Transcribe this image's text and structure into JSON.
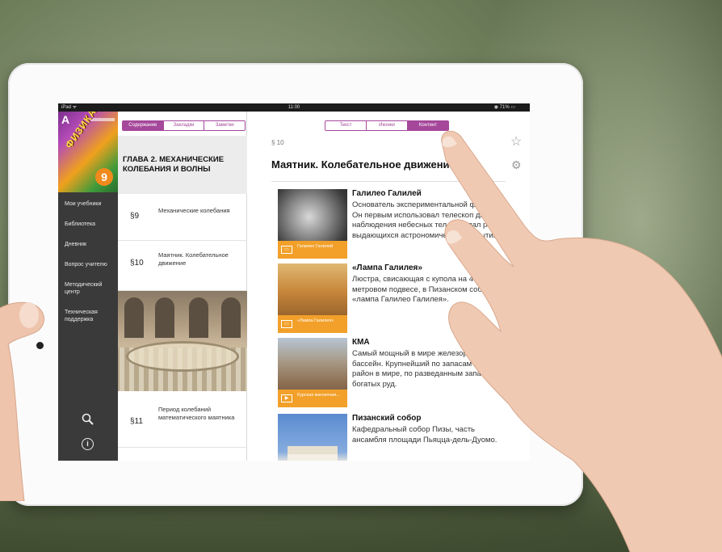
{
  "statusbar": {
    "carrier": "iPad ᯤ",
    "time": "11:00",
    "battery": "◉ 71% ▭"
  },
  "cover": {
    "letter": "A",
    "title": "ФИЗИКА",
    "grade": "9"
  },
  "sidebar": {
    "items": [
      {
        "label": "Мои учебники"
      },
      {
        "label": "Библиотека"
      },
      {
        "label": "Дневник"
      },
      {
        "label": "Вопрос учителю"
      },
      {
        "label": "Методический центр"
      },
      {
        "label": "Техническая поддержка"
      }
    ],
    "icons": {
      "search": "search-icon",
      "info": "info-icon",
      "info_glyph": "i"
    }
  },
  "toc": {
    "tabs": [
      {
        "label": "Содержание",
        "active": true
      },
      {
        "label": "Закладки",
        "active": false
      },
      {
        "label": "Заметки",
        "active": false
      }
    ],
    "chapter": "ГЛАВА 2. МЕХАНИЧЕСКИЕ КОЛЕБАНИЯ И ВОЛНЫ",
    "items": [
      {
        "num": "§9",
        "name": "Механические колебания"
      },
      {
        "num": "§10",
        "name": "Маятник. Колебательное движение"
      },
      {
        "num": "§11",
        "name": "Период колебаний математического маятника"
      }
    ]
  },
  "content": {
    "tabs": [
      {
        "label": "Текст",
        "active": false
      },
      {
        "label": "Иконки",
        "active": false
      },
      {
        "label": "Контент",
        "active": true
      }
    ],
    "paragraph": "§ 10",
    "title": "Маятник. Колебательное движение",
    "icons": {
      "star": "☆",
      "gear": "⚙"
    },
    "cards": [
      {
        "title": "Галилео Галилей",
        "text": "Основатель экспериментальной физики. Он первым использовал телескоп для наблюдения небесных тел и сделал ряд выдающихся астрономических открытий.",
        "caption": "Галилео Галилей",
        "icon": "image-icon",
        "glyph": "▭"
      },
      {
        "title": "«Лампа Галилея»",
        "text": "Люстра, свисающая с купола на 49-метровом подвесе, в Пизанском соборе — «лампа Галилео Галилея».",
        "caption": "«Лампа Галилея»",
        "icon": "image-icon",
        "glyph": "▭"
      },
      {
        "title": "КМА",
        "text": "Самый мощный в мире железорудный бассейн. Крупнейший по запасам железа район в мире, по разведанным запасам богатых руд.",
        "caption": "Курская магнитная...",
        "icon": "video-icon",
        "glyph": "▶"
      },
      {
        "title": "Пизанский собор",
        "text": "Кафедральный собор Пизы, часть ансамбля площади Пьяцца-дель-Дуомо.",
        "caption": "",
        "icon": "image-icon",
        "glyph": ""
      }
    ]
  },
  "colors": {
    "accent": "#a5479b",
    "caption": "#f2a02a",
    "sidebar": "#3a3a3a"
  }
}
